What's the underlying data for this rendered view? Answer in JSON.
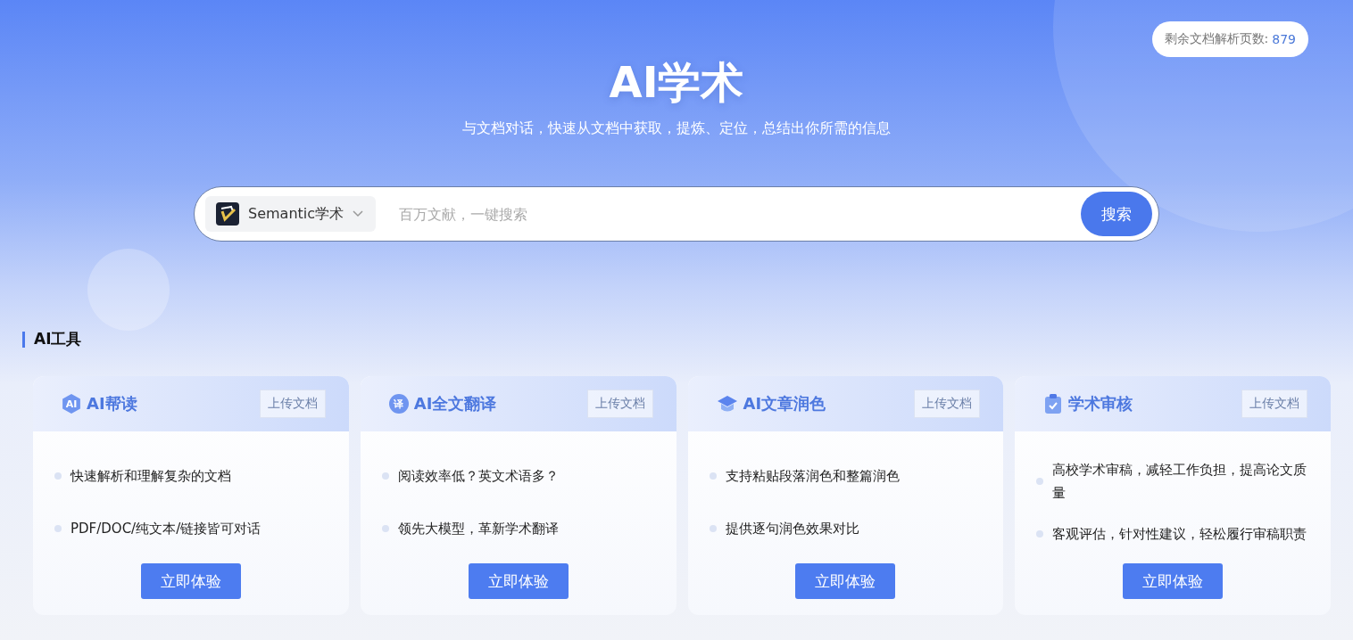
{
  "quota": {
    "label": "剩余文档解析页数:",
    "value": "879"
  },
  "hero": {
    "title": "AI学术",
    "subtitle": "与文档对话，快速从文档中获取，提炼、定位，总结出你所需的信息"
  },
  "search": {
    "source": "Semantic学术",
    "placeholder": "百万文献，一键搜索",
    "button": "搜索"
  },
  "section": {
    "title": "AI工具"
  },
  "cards": [
    {
      "icon": {
        "kind": "hexagon",
        "text": "AI"
      },
      "title": "AI帮读",
      "upload": "上传文档",
      "points": [
        "快速解析和理解复杂的文档",
        "PDF/DOC/纯文本/链接皆可对话"
      ],
      "button": "立即体验"
    },
    {
      "icon": {
        "kind": "circle",
        "text": "译"
      },
      "title": "AI全文翻译",
      "upload": "上传文档",
      "points": [
        "阅读效率低？英文术语多？",
        "领先大模型，革新学术翻译"
      ],
      "button": "立即体验"
    },
    {
      "icon": {
        "kind": "cap"
      },
      "title": "AI文章润色",
      "upload": "上传文档",
      "points": [
        "支持粘贴段落润色和整篇润色",
        "提供逐句润色效果对比"
      ],
      "button": "立即体验"
    },
    {
      "icon": {
        "kind": "clipboard"
      },
      "title": "学术审核",
      "upload": "上传文档",
      "points": [
        "高校学术审稿，减轻工作负担，提高论文质量",
        "客观评估，针对性建议，轻松履行审稿职责"
      ],
      "button": "立即体验"
    }
  ]
}
